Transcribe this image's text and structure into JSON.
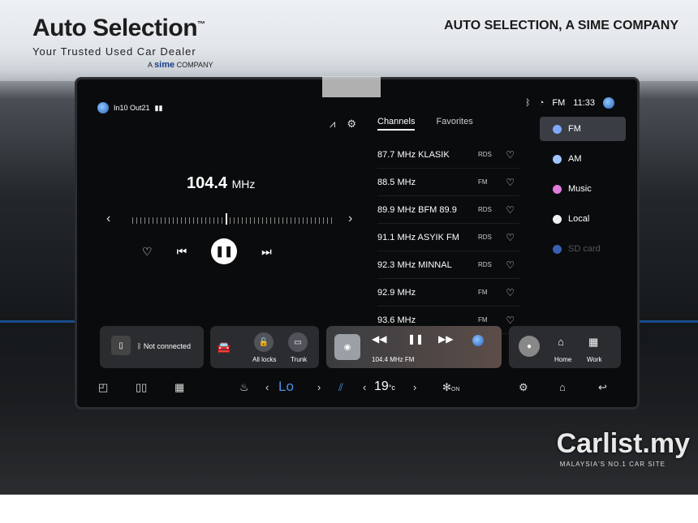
{
  "banner": {
    "brand": "Auto Selection",
    "brand_tm": "™",
    "tagline": "Your Trusted Used Car Dealer",
    "sime_prefix": "A",
    "sime": "sime",
    "sime_suffix": "COMPANY",
    "company": "AUTO SELECTION, A SIME COMPANY"
  },
  "watermark": {
    "name": "Carlist.my",
    "sub": "MALAYSIA'S NO.1 CAR SITE"
  },
  "status": {
    "date": "In10 Out21",
    "band": "FM",
    "time": "11:33"
  },
  "player": {
    "frequency": "104.4",
    "unit": "MHz"
  },
  "tabs": [
    {
      "label": "Channels"
    },
    {
      "label": "Favorites"
    }
  ],
  "channels": [
    {
      "freq": "87.7 MHz  KLASIK",
      "tag": "RDS"
    },
    {
      "freq": "88.5 MHz",
      "tag": "FM"
    },
    {
      "freq": "89.9 MHz  BFM 89.9",
      "tag": "RDS"
    },
    {
      "freq": "91.1 MHz  ASYIK FM",
      "tag": "RDS"
    },
    {
      "freq": "92.3 MHz  MINNAL",
      "tag": "RDS"
    },
    {
      "freq": "92.9 MHz",
      "tag": "FM"
    },
    {
      "freq": "93.6 MHz",
      "tag": "FM"
    }
  ],
  "sources": [
    {
      "label": "FM",
      "color": "#7fa8ff"
    },
    {
      "label": "AM",
      "color": "#9fc4ff"
    },
    {
      "label": "Music",
      "color": "#e07be0"
    },
    {
      "label": "Local",
      "color": "#f0f0f0"
    },
    {
      "label": "SD card",
      "color": "#3a5fb0"
    }
  ],
  "dock": {
    "phone": "Not connected",
    "all_locks": "All locks",
    "trunk": "Trunk",
    "media_info": "104.4 MHz  FM",
    "home": "Home",
    "work": "Work"
  },
  "climate": {
    "fan": "Lo",
    "temp": "19",
    "unit": "°c",
    "on": "ON"
  }
}
